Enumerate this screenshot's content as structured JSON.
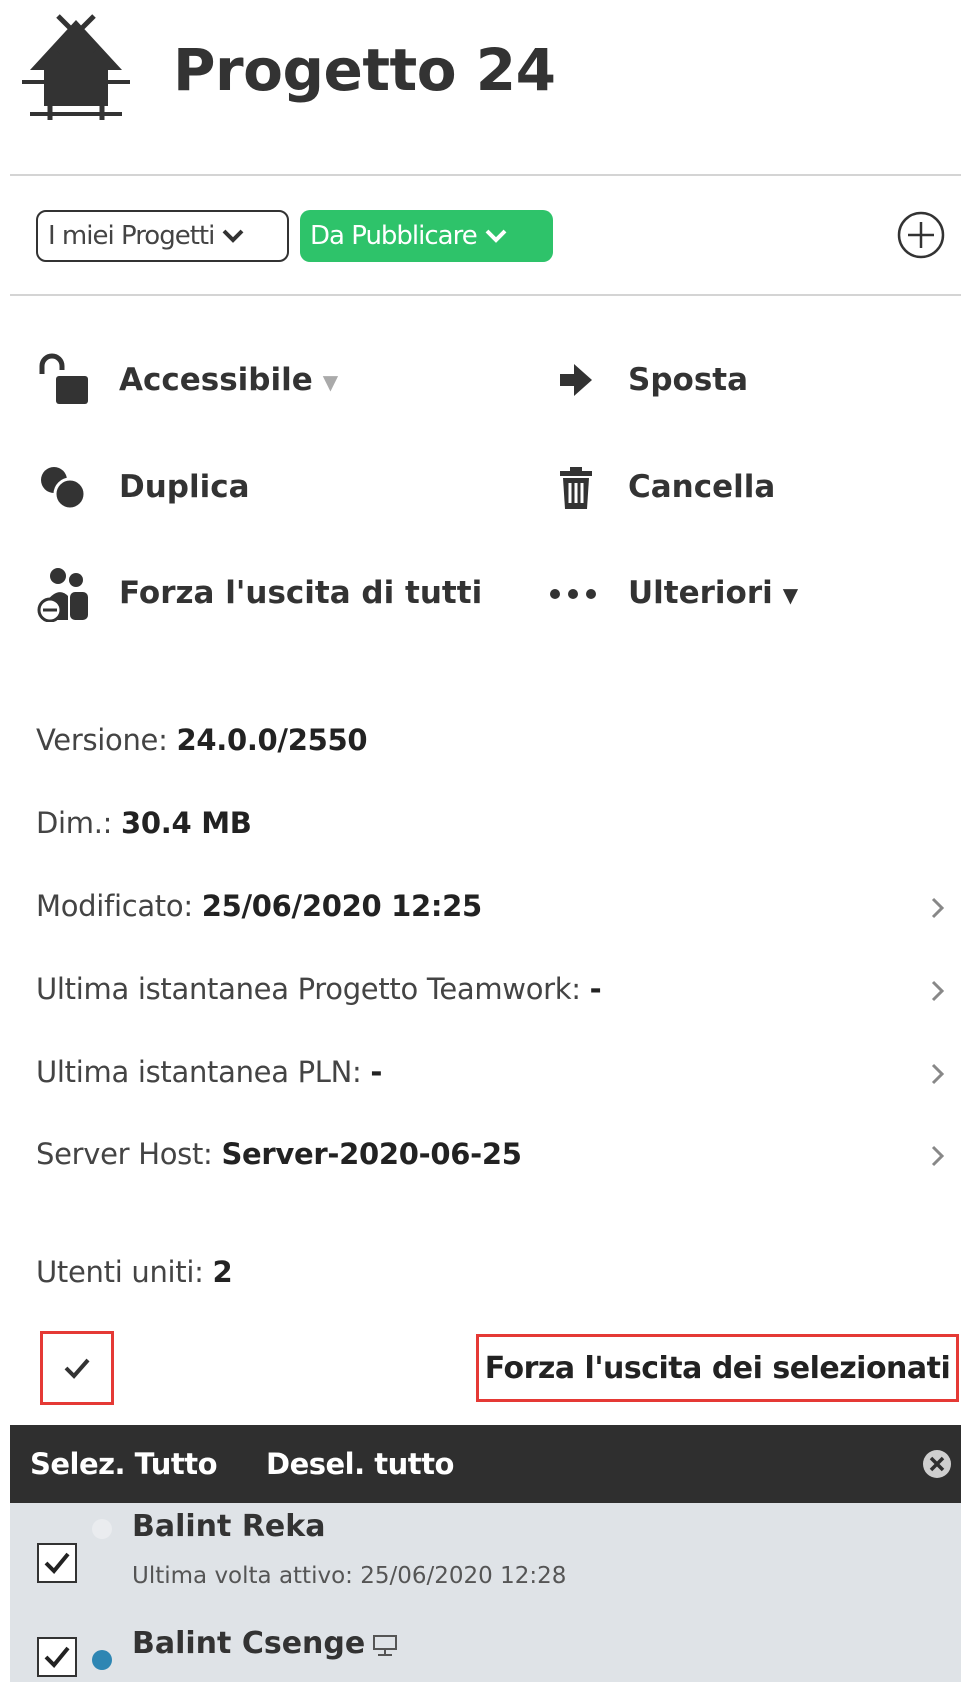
{
  "header": {
    "icon": "house-icon",
    "title": "Progetto 24"
  },
  "filters": {
    "my_projects": "I miei Progetti",
    "status": "Da Pubblicare",
    "status_color": "#2ec36a",
    "add_icon": "plus-circle-icon"
  },
  "actions": {
    "accessible": "Accessibile",
    "move": "Sposta",
    "duplicate": "Duplica",
    "delete": "Cancella",
    "force_all": "Forza l'uscita di tutti",
    "more": "Ulteriori"
  },
  "info": {
    "version_label": "Versione: ",
    "version_value": "24.0.0/2550",
    "size_label": "Dim.: ",
    "size_value": "30.4 MB",
    "modified_label": "Modificato: ",
    "modified_value": "25/06/2020 12:25",
    "teamwork_label": "Ultima istantanea Progetto Teamwork: ",
    "teamwork_value": "-",
    "pln_label": "Ultima istantanea PLN: ",
    "pln_value": "-",
    "host_label": "Server Host: ",
    "host_value": "Server-2020-06-25"
  },
  "users": {
    "joined_label": "Utenti uniti: ",
    "joined_count": "2",
    "force_selected": "Forza l'uscita dei selezionati",
    "select_all": "Selez. Tutto",
    "deselect_all": "Desel. tutto",
    "list": [
      {
        "name": "Balint Reka",
        "last_active": "Ultima volta attivo: 25/06/2020 12:28",
        "checked": true,
        "status_color": "#eaecef"
      },
      {
        "name": "Balint Csenge",
        "checked": true,
        "status_color": "#2e86b3",
        "device_icon": "monitor-icon"
      }
    ]
  },
  "colors": {
    "highlight": "#e53935",
    "toolbar": "#2f2f2f",
    "list_bg": "#dfe3e7"
  }
}
